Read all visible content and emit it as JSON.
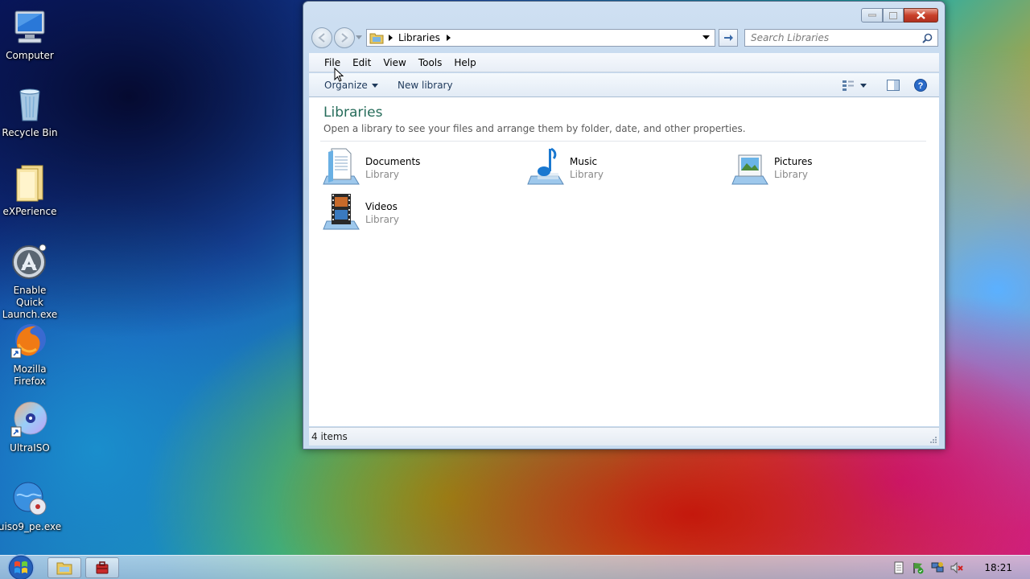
{
  "desktop": {
    "icons": [
      {
        "label": "Computer"
      },
      {
        "label": "Recycle Bin"
      },
      {
        "label": "eXPerience"
      },
      {
        "label": "Enable Quick Launch.exe"
      },
      {
        "label": "Mozilla Firefox"
      },
      {
        "label": "UltraISO"
      },
      {
        "label": "uiso9_pe.exe"
      }
    ]
  },
  "window": {
    "address": {
      "crumb": "Libraries"
    },
    "search": {
      "placeholder": "Search Libraries"
    },
    "menu": [
      "File",
      "Edit",
      "View",
      "Tools",
      "Help"
    ],
    "toolbar": {
      "organize_label": "Organize",
      "new_library_label": "New library"
    },
    "content": {
      "title": "Libraries",
      "description": "Open a library to see your files and arrange them by folder, date, and other properties.",
      "libraries": [
        {
          "name": "Documents",
          "type": "Library"
        },
        {
          "name": "Music",
          "type": "Library"
        },
        {
          "name": "Pictures",
          "type": "Library"
        },
        {
          "name": "Videos",
          "type": "Library"
        }
      ]
    },
    "status": {
      "items_text": "4 items"
    }
  },
  "taskbar": {
    "clock": "18:21"
  }
}
